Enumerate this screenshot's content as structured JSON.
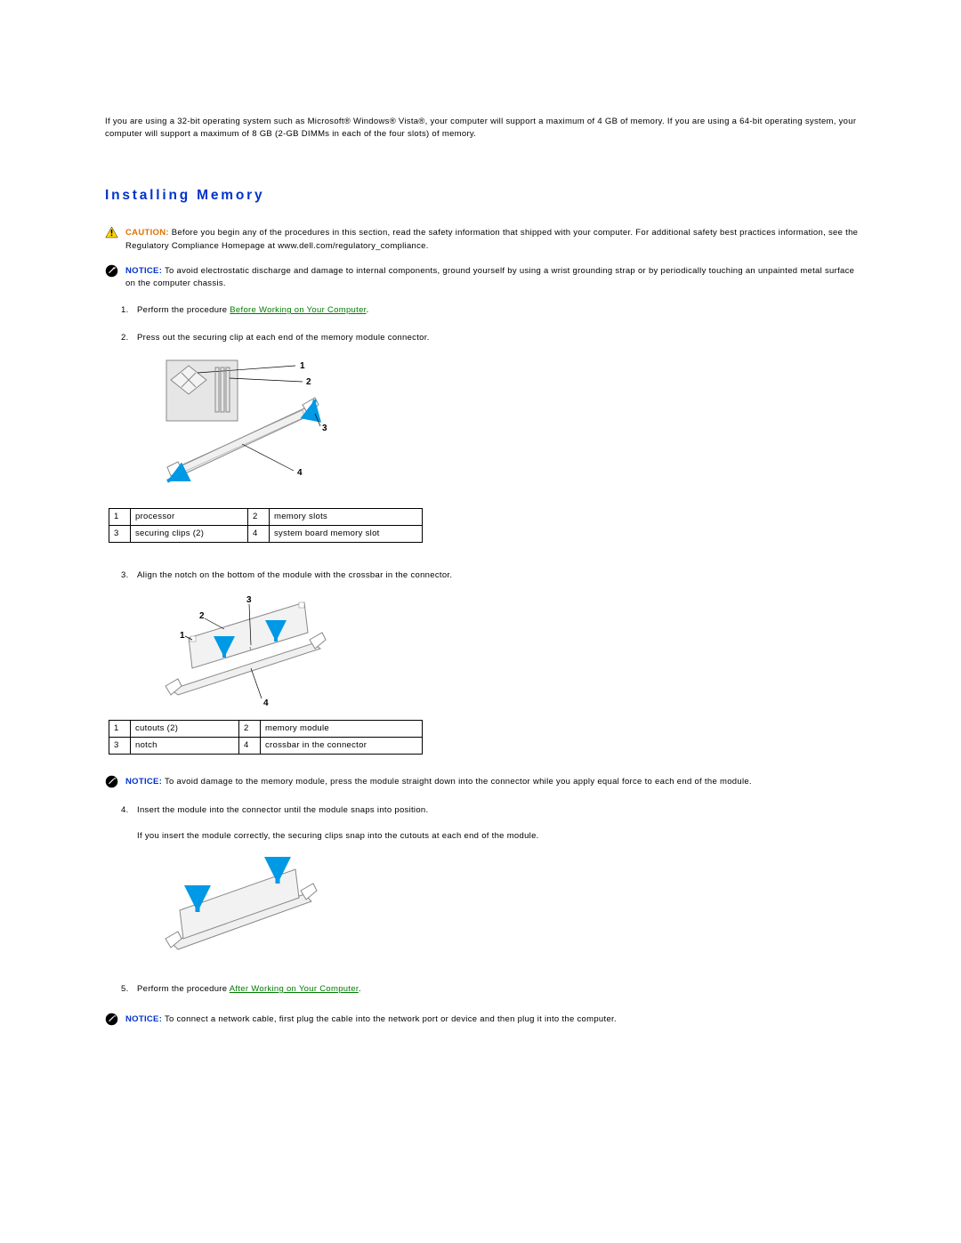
{
  "intro": "If you are using a 32-bit operating system such as Microsoft® Windows® Vista®, your computer will support a maximum of 4 GB of memory. If you are using a 64-bit operating system, your computer will support a maximum of 8 GB (2-GB DIMMs in each of the four slots) of memory.",
  "heading": "Installing Memory",
  "caution": {
    "label": "CAUTION:",
    "text": "Before you begin any of the procedures in this section, read the safety information that shipped with your computer. For additional safety best practices information, see the Regulatory Compliance Homepage at www.dell.com/regulatory_compliance."
  },
  "notice1": {
    "label": "NOTICE:",
    "text": "To avoid electrostatic discharge and damage to internal components, ground yourself by using a wrist grounding strap or by periodically touching an unpainted metal surface on the computer chassis."
  },
  "step1": {
    "num": "1.",
    "prefix": "Perform the procedure ",
    "link": "Before Working on Your Computer",
    "suffix": "."
  },
  "step2": {
    "num": "2.",
    "text": "Press out the securing clip at each end of the memory module connector."
  },
  "legend1": {
    "r1c1": "1",
    "r1c2": "processor",
    "r1c3": "2",
    "r1c4": "memory slots",
    "r2c1": "3",
    "r2c2": "securing clips (2)",
    "r2c3": "4",
    "r2c4": "system board memory slot"
  },
  "step3": {
    "num": "3.",
    "text": "Align the notch on the bottom of the module with the crossbar in the connector."
  },
  "legend2": {
    "r1c1": "1",
    "r1c2": "cutouts (2)",
    "r1c3": "2",
    "r1c4": "memory module",
    "r2c1": "3",
    "r2c2": "notch",
    "r2c3": "4",
    "r2c4": "crossbar in the connector"
  },
  "notice2": {
    "label": "NOTICE:",
    "text": "To avoid damage to the memory module, press the module straight down into the connector while you apply equal force to each end of the module."
  },
  "step4": {
    "num": "4.",
    "text": "Insert the module into the connector until the module snaps into position."
  },
  "step4_sub": "If you insert the module correctly, the securing clips snap into the cutouts at each end of the module.",
  "step5": {
    "num": "5.",
    "prefix": "Perform the procedure ",
    "link": "After Working on Your Computer",
    "suffix": "."
  },
  "notice3": {
    "label": "NOTICE:",
    "text": "To connect a network cable, first plug the cable into the network port or device and then plug it into the computer."
  },
  "fig1": {
    "l1": "1",
    "l2": "2",
    "l3": "3",
    "l4": "4"
  },
  "fig2": {
    "l1": "1",
    "l2": "2",
    "l3": "3",
    "l4": "4"
  }
}
